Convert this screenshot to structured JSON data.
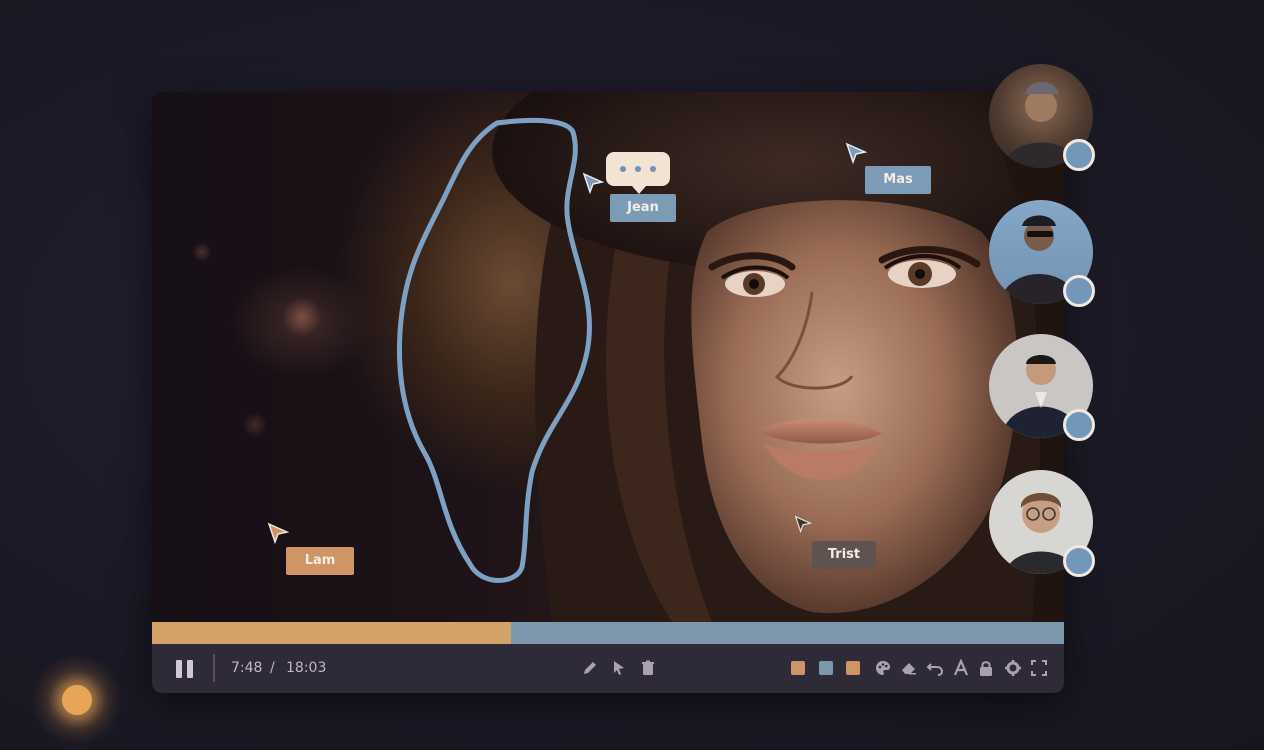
{
  "player": {
    "playback": {
      "current_time": "7:48",
      "separator": "/",
      "duration": "18:03",
      "progress_fraction": 0.394
    },
    "colors": {
      "progress_fill": "#d3a266",
      "progress_track": "#7d98ad",
      "annotation_stroke": "#7da1c2",
      "control_bar": "#2e2a37"
    }
  },
  "collaborators": {
    "cursors": [
      {
        "name": "Jean",
        "tag_color": "#7c9bb6",
        "has_chat_bubble": true
      },
      {
        "name": "Mas",
        "tag_color": "#7c9bb6"
      },
      {
        "name": "Lam",
        "tag_color": "#cf9565"
      },
      {
        "name": "Trist",
        "tag_color": "#5e534f"
      }
    ],
    "avatars": [
      {
        "id": "participant-1",
        "badge_color": "#7397b8"
      },
      {
        "id": "participant-2",
        "badge_color": "#7397b8"
      },
      {
        "id": "participant-3",
        "badge_color": "#7397b8"
      },
      {
        "id": "participant-4",
        "badge_color": "#7397b8"
      }
    ]
  },
  "toolbar": {
    "center_tools": [
      "pencil-icon",
      "pointer-icon",
      "trash-icon"
    ],
    "color_swatches": [
      "#cf9565",
      "#7d98ad",
      "#cf9565"
    ],
    "right_tools": [
      "palette-icon",
      "eraser-icon",
      "undo-icon",
      "text-icon",
      "lock-icon",
      "settings-icon",
      "fullscreen-icon"
    ]
  }
}
